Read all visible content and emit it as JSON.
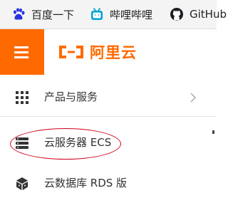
{
  "bookmarks": [
    {
      "label": "百度一下",
      "icon": "paw-icon"
    },
    {
      "label": "哔哩哔哩",
      "icon": "tv-icon"
    },
    {
      "label": "GitHub",
      "icon": "github-icon"
    }
  ],
  "header": {
    "menu_icon": "hamburger-icon",
    "logo_text": "阿里云",
    "logo_mark": "bracket-logo-mark"
  },
  "menu": {
    "items": [
      {
        "label": "产品与服务",
        "icon": "grid-icon",
        "has_arrow": true
      },
      {
        "label": "云服务器 ECS",
        "icon": "server-icon",
        "highlighted": true
      },
      {
        "label": "云数据库 RDS 版",
        "icon": "database-icon"
      }
    ]
  },
  "colors": {
    "brand": "#ff6a00",
    "highlight": "#d0021b",
    "bookmark_bar": "#f4f4f4",
    "baidu": "#2932e1",
    "bilibili": "#00a1d6"
  }
}
